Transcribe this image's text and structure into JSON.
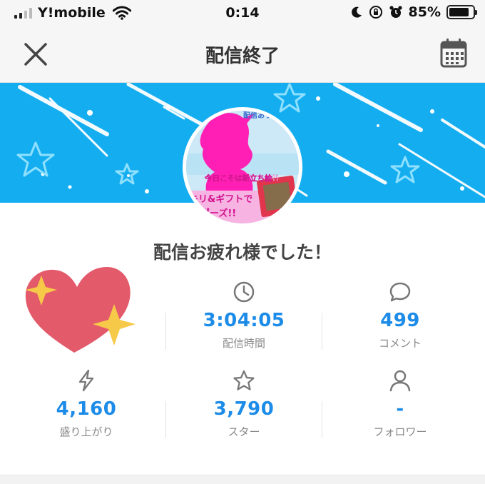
{
  "status_bar": {
    "carrier": "Y!mobile",
    "time": "0:14",
    "battery_percent": "85%",
    "battery_level": 0.85
  },
  "nav": {
    "title": "配信終了"
  },
  "avatar": {
    "texts": [
      "配信ありがとう",
      "今日こそは新立ち絵!!",
      "キリ&ギフトで",
      "ポーズ!!"
    ]
  },
  "message": "配信お疲れ様でした！",
  "stats": [
    {
      "icon": "clock-icon",
      "value": "3:04:05",
      "label": "配信時間"
    },
    {
      "icon": "comment-icon",
      "value": "499",
      "label": "コメント"
    },
    {
      "icon": "lightning-icon",
      "value": "4,160",
      "label": "盛り上がり"
    },
    {
      "icon": "star-icon",
      "value": "3,790",
      "label": "スター"
    },
    {
      "icon": "person-icon",
      "value": "-",
      "label": "フォロワー"
    }
  ],
  "colors": {
    "accent": "#1c8ce8",
    "banner": "#14aef0",
    "heart": "#e35a6b",
    "sparkle": "#f7c948"
  }
}
